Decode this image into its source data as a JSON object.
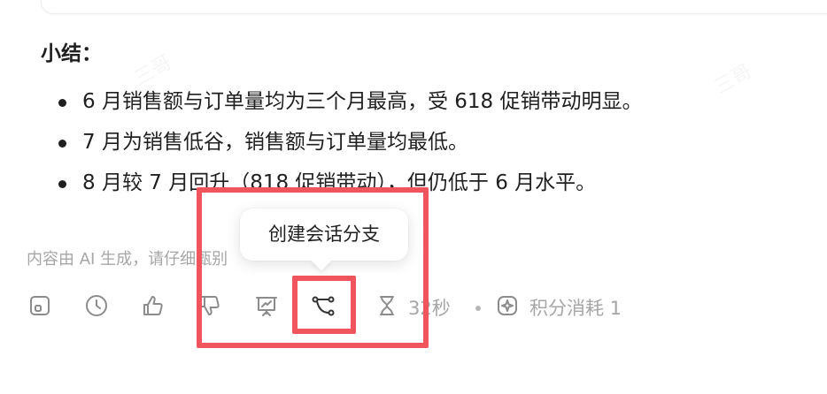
{
  "summary": {
    "heading": "小结：",
    "bullets": [
      "6 月销售额与订单量均为三个月最高，受 618 促销带动明显。",
      "7 月为销售低谷，销售额与订单量均最低。",
      "8 月较 7 月回升（818 促销带动），但仍低于 6 月水平。"
    ]
  },
  "disclaimer": "内容由 AI 生成，请仔细甄别",
  "tooltip": {
    "text": "创建会话分支"
  },
  "toolbar": {
    "icons": [
      "copy-icon",
      "history-icon",
      "thumbs-up-icon",
      "thumbs-down-icon",
      "presentation-icon",
      "branch-icon",
      "hourglass-icon",
      "sparkle-icon"
    ],
    "duration": "32秒",
    "points": "积分消耗 1"
  },
  "watermark": "三哥",
  "colors": {
    "highlight": "#f0545c",
    "muted": "#8c8c8c",
    "text": "#1f1f1f"
  }
}
